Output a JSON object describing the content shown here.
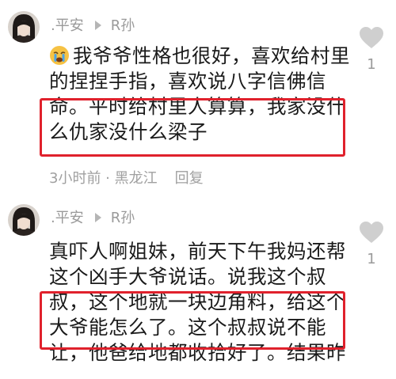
{
  "comments": [
    {
      "username": ".平安",
      "reply_to": "R孙",
      "emoji": "crying-face",
      "lines": [
        "我爷爷性格也很好，喜欢给村里",
        "的捏捏手指，喜欢说八字信佛信",
        "命。平时给村里人算算，我家没什",
        "么仇家没什么梁子"
      ],
      "time": "3小时前 · 黑龙江",
      "reply_label": "回复",
      "likes": "1"
    },
    {
      "username": ".平安",
      "reply_to": "R孙",
      "lines": [
        "真吓人啊姐妹，前天下午我妈还帮",
        "这个凶手大爷说话。说我这个叔",
        "叔，这个地就一块边角料，给这个",
        "大爷能怎么了。这个叔叔说不能",
        "让，他爸给地都收拾好了。结果昨"
      ],
      "likes": "1"
    }
  ],
  "colors": {
    "highlight": "#e0212c",
    "secondary_text": "#9a9a9a"
  },
  "icons": [
    "reply-arrow-icon",
    "heart-icon",
    "crying-face-emoji"
  ]
}
